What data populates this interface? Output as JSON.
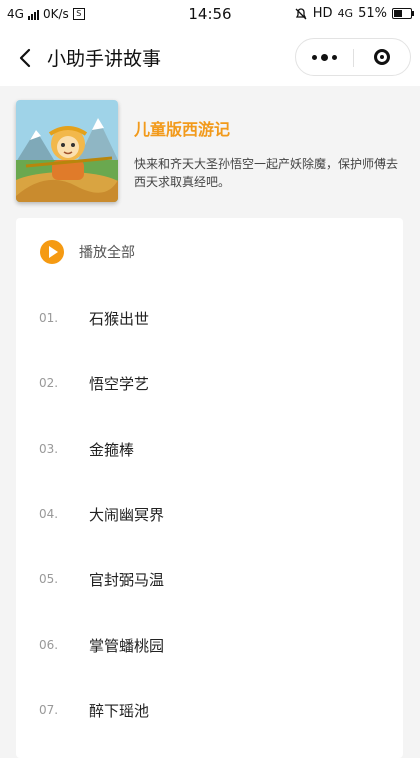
{
  "statusbar": {
    "network": "4G",
    "speed": "0K/s",
    "sim_icon": "S",
    "time": "14:56",
    "hd": "HD",
    "network2": "4G",
    "battery": "51%",
    "battery_level": 0.51
  },
  "navbar": {
    "title": "小助手讲故事"
  },
  "book": {
    "title": "儿童版西游记",
    "description": "快来和齐天大圣孙悟空一起产妖除魔，保护师傅去西天求取真经吧。"
  },
  "playlist": {
    "play_all": "播放全部",
    "items": [
      {
        "num": "01.",
        "title": "石猴出世"
      },
      {
        "num": "02.",
        "title": "悟空学艺"
      },
      {
        "num": "03.",
        "title": "金箍棒"
      },
      {
        "num": "04.",
        "title": "大闹幽冥界"
      },
      {
        "num": "05.",
        "title": "官封弼马温"
      },
      {
        "num": "06.",
        "title": "掌管蟠桃园"
      },
      {
        "num": "07.",
        "title": "醉下瑶池"
      }
    ]
  },
  "colors": {
    "accent": "#f29a1b",
    "play_button": "#f59a12"
  }
}
